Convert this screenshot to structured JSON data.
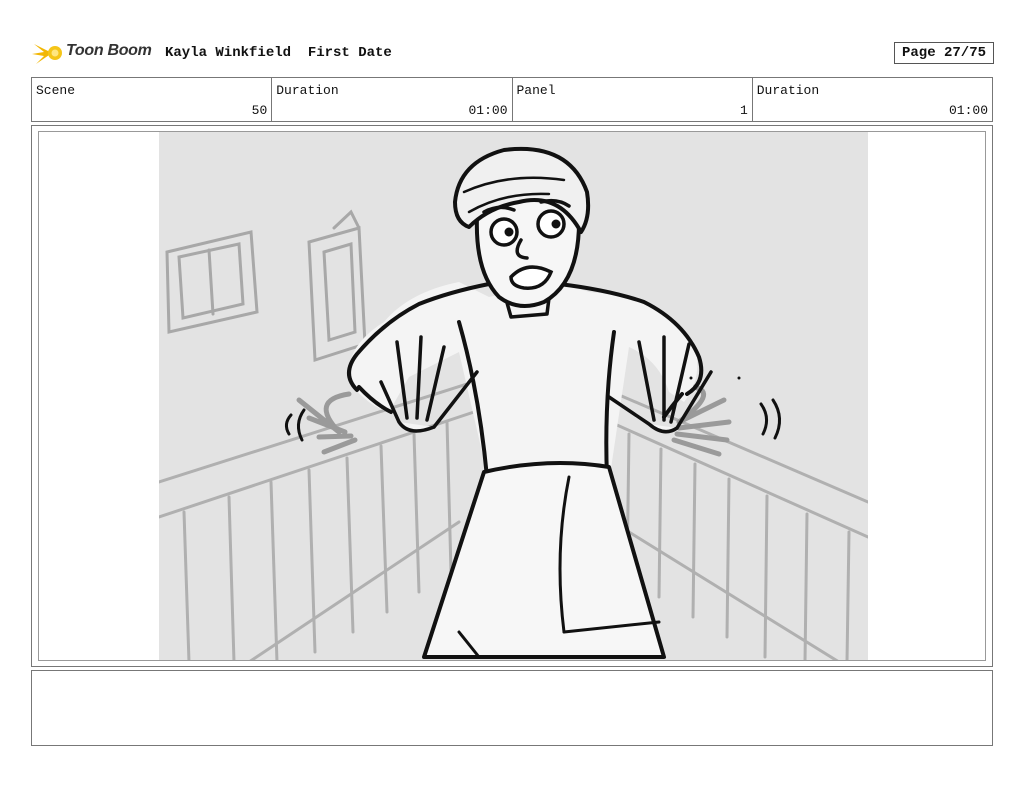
{
  "header": {
    "logo_text": "Toon Boom",
    "project": "Kayla Winkfield  First Date",
    "page": "Page 27/75"
  },
  "info": [
    {
      "label": "Scene",
      "value": "50"
    },
    {
      "label": "Duration",
      "value": "01:00"
    },
    {
      "label": "Panel",
      "value": "1"
    },
    {
      "label": "Duration",
      "value": "01:00"
    }
  ],
  "notes": ""
}
